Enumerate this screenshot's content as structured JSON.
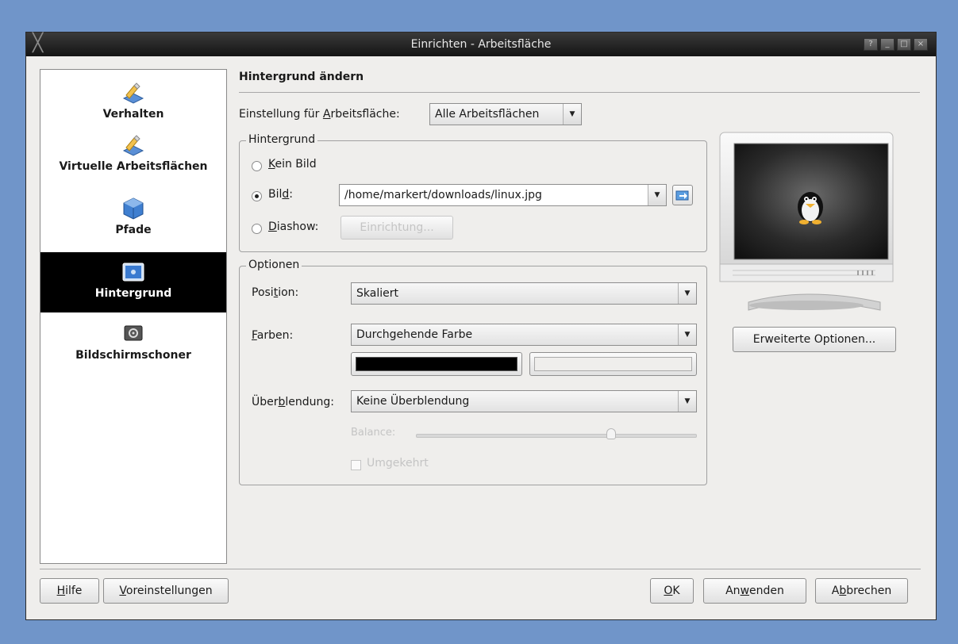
{
  "window": {
    "title": "Einrichten - Arbeitsfläche",
    "controls": [
      "?",
      "_",
      "□",
      "×"
    ]
  },
  "sidebar": {
    "items": [
      {
        "label": "Verhalten",
        "icon": "behavior-icon"
      },
      {
        "label": "Virtuelle Arbeitsflächen",
        "icon": "virtual-desktops-icon"
      },
      {
        "label": "Pfade",
        "icon": "paths-icon"
      },
      {
        "label": "Hintergrund",
        "icon": "background-icon",
        "active": true
      },
      {
        "label": "Bildschirmschoner",
        "icon": "screensaver-icon"
      }
    ]
  },
  "main": {
    "section_title": "Hintergrund ändern",
    "desktop_setting": {
      "label_pre": "Einstellung für ",
      "label_u": "A",
      "label_post": "rbeitsfläche:",
      "value": "Alle Arbeitsflächen"
    },
    "background_group": {
      "title": "Hintergrund",
      "no_image": {
        "u": "K",
        "rest": "ein Bild"
      },
      "image": {
        "pre": "Bil",
        "u": "d",
        "post": ":",
        "path": "/home/markert/downloads/linux.jpg"
      },
      "slideshow": {
        "u": "D",
        "rest": "iashow:",
        "button": "Einrichtung..."
      }
    },
    "options_group": {
      "title": "Optionen",
      "position": {
        "pre": "Posi",
        "u": "t",
        "post": "ion:",
        "value": "Skaliert"
      },
      "colors": {
        "u": "F",
        "rest": "arben:",
        "value": "Durchgehende Farbe",
        "color1": "#000000",
        "color2": "#efeeec"
      },
      "blending": {
        "pre": "Über",
        "u": "b",
        "post": "lendung:",
        "value": "Keine Überblendung"
      },
      "balance_label": "Balance:",
      "balance_value": 0.7,
      "reversed_label": "Umgekehrt"
    },
    "advanced_button": "Erweiterte Optionen..."
  },
  "footer": {
    "help": {
      "u": "H",
      "rest": "ilfe"
    },
    "defaults": {
      "u": "V",
      "rest": "oreinstellungen"
    },
    "ok": {
      "u": "O",
      "rest": "K"
    },
    "apply": {
      "pre": "An",
      "u": "w",
      "post": "enden"
    },
    "cancel": {
      "pre": "A",
      "u": "b",
      "post": "brechen"
    }
  },
  "colors": {
    "desktop_bg": "#7095c9",
    "titlebar": "#1e1e1e",
    "window_bg": "#efeeec",
    "selection": "#000000"
  }
}
